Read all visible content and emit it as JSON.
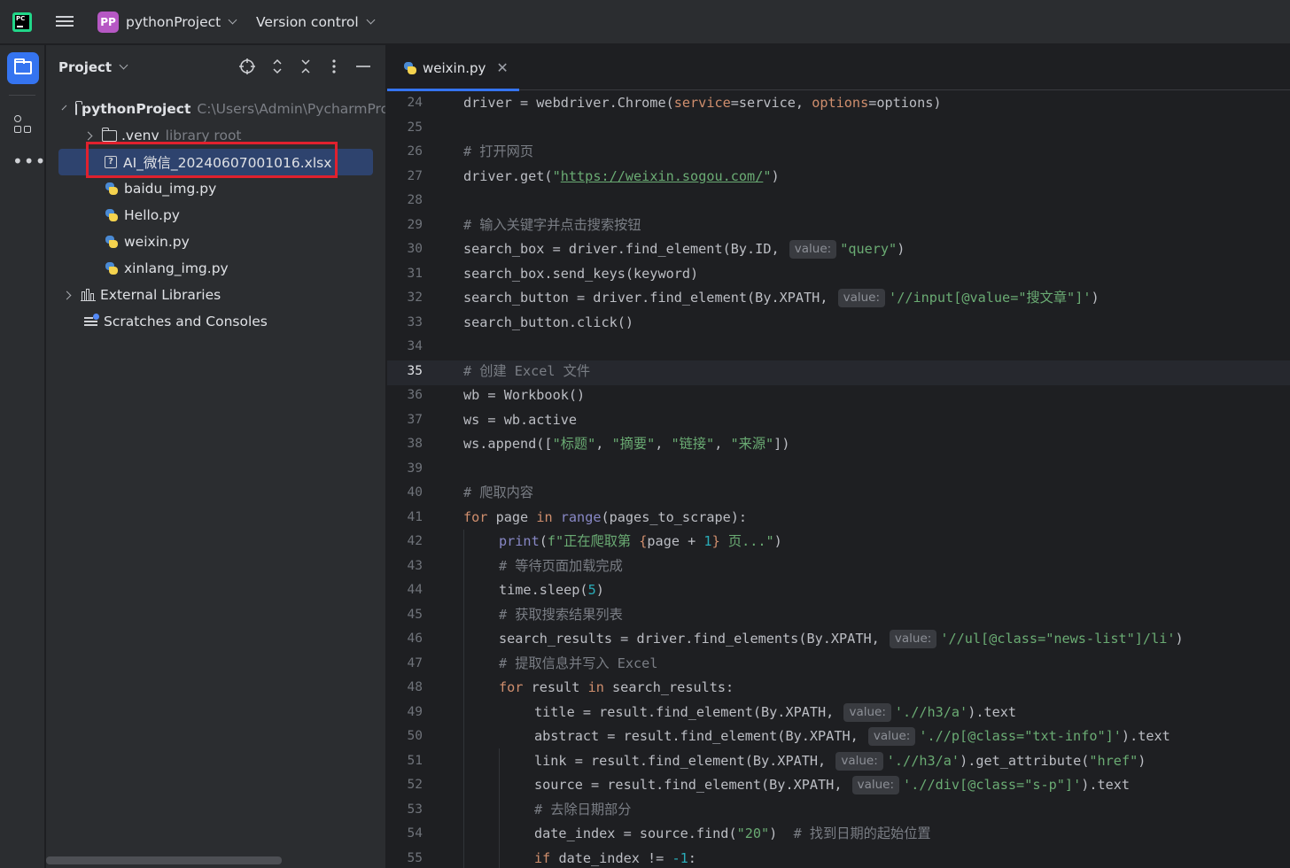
{
  "titlebar": {
    "logo_text": "PC",
    "project_avatar": "PP",
    "project_name": "pythonProject",
    "vcs_label": "Version control"
  },
  "project_panel": {
    "title": "Project",
    "tree": {
      "root_name": "pythonProject",
      "root_path": "C:\\Users\\Admin\\PycharmPro",
      "venv_name": ".venv",
      "venv_note": "library root",
      "files": [
        "AI_微信_20240607001016.xlsx",
        "baidu_img.py",
        "Hello.py",
        "weixin.py",
        "xinlang_img.py"
      ],
      "external_libraries": "External Libraries",
      "scratches": "Scratches and Consoles"
    }
  },
  "editor": {
    "tab_name": "weixin.py",
    "current_line": 35,
    "hint_label": "value:",
    "line_numbers": [
      "24",
      "25",
      "26",
      "27",
      "28",
      "29",
      "30",
      "31",
      "32",
      "33",
      "34",
      "35",
      "36",
      "37",
      "38",
      "39",
      "40",
      "41",
      "42",
      "43",
      "44",
      "45",
      "46",
      "47",
      "48",
      "49",
      "50",
      "51",
      "52",
      "53",
      "54",
      "55"
    ],
    "code": {
      "l24": {
        "a": "driver = webdriver.Chrome(",
        "b": "service",
        "c": "=service, ",
        "d": "options",
        "e": "=options)"
      },
      "l26": "# 打开网页",
      "l27": {
        "a": "driver.get(",
        "q1": "\"",
        "url": "https://weixin.sogou.com/",
        "q2": "\"",
        "b": ")"
      },
      "l29": "# 输入关键字并点击搜索按钮",
      "l30": {
        "a": "search_box = driver.find_element(By.ID, ",
        "s": "\"query\"",
        "b": ")"
      },
      "l31": "search_box.send_keys(keyword)",
      "l32": {
        "a": "search_button = driver.find_element(By.XPATH, ",
        "s": "'//input[@value=\"搜文章\"]'",
        "b": ")"
      },
      "l33": "search_button.click()",
      "l35": "# 创建 Excel 文件",
      "l36": "wb = Workbook()",
      "l37": "ws = wb.active",
      "l38": {
        "a": "ws.append([",
        "s1": "\"标题\"",
        "c1": ", ",
        "s2": "\"摘要\"",
        "c2": ", ",
        "s3": "\"链接\"",
        "c3": ", ",
        "s4": "\"来源\"",
        "b": "])"
      },
      "l40": "# 爬取内容",
      "l41": {
        "kw1": "for",
        "a": " page ",
        "kw2": "in",
        "sp": " ",
        "fn": "range",
        "b": "(pages_to_scrape):"
      },
      "l42": {
        "fn": "print",
        "a": "(",
        "s1": "f\"正在爬取第 ",
        "b1": "{",
        "v": "page + ",
        "n": "1",
        "b2": "}",
        "s2": " 页...\"",
        "c": ")"
      },
      "l43": "# 等待页面加载完成",
      "l44": {
        "a": "time.sleep(",
        "n": "5",
        "b": ")"
      },
      "l45": "# 获取搜索结果列表",
      "l46": {
        "a": "search_results = driver.find_elements(By.XPATH, ",
        "s": "'//ul[@class=\"news-list\"]/li'",
        "b": ")"
      },
      "l47": "# 提取信息并写入 Excel",
      "l48": {
        "kw1": "for",
        "a": " result ",
        "kw2": "in",
        "b": " search_results:"
      },
      "l49": {
        "a": "title = result.find_element(By.XPATH, ",
        "s": "'.//h3/a'",
        "b": ").text"
      },
      "l50": {
        "a": "abstract = result.find_element(By.XPATH, ",
        "s": "'.//p[@class=\"txt-info\"]'",
        "b": ").text"
      },
      "l51": {
        "a": "link = result.find_element(By.XPATH, ",
        "s": "'.//h3/a'",
        "b": ").get_attribute(",
        "s2": "\"href\"",
        "c": ")"
      },
      "l52": {
        "a": "source = result.find_element(By.XPATH, ",
        "s": "'.//div[@class=\"s-p\"]'",
        "b": ").text"
      },
      "l53": "# 去除日期部分",
      "l54": {
        "a": "date_index = source.find(",
        "s": "\"20\"",
        "b": ")  ",
        "cmt": "# 找到日期的起始位置"
      },
      "l55": {
        "kw": "if",
        "a": " date_index != ",
        "n": "-1",
        "b": ":"
      }
    }
  },
  "colors": {
    "accent": "#3574f0",
    "selection": "#2e436e",
    "highlight_box": "#e0212e"
  }
}
